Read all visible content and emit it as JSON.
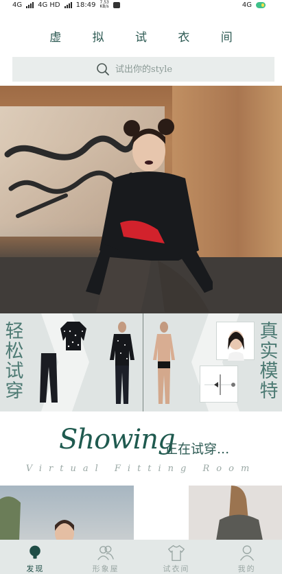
{
  "status_bar": {
    "network_left": "4G",
    "network_left_2": "4G HD",
    "time": "18:49",
    "speed": "7.53 KB/s",
    "network_right": "4G",
    "battery_color": "#3ec08a"
  },
  "header": {
    "title": "虚 拟 试 衣 间"
  },
  "search": {
    "placeholder": "试出你的style",
    "icon": "search-icon"
  },
  "banner": {
    "slide_count": 5,
    "active_slide": 3
  },
  "features": {
    "left_label": "轻松试穿",
    "right_label": "真实模特"
  },
  "showing": {
    "script_text": "Showing",
    "chinese_text": "正在试穿...",
    "subtitle": "Virtual Fitting Room"
  },
  "tabbar": {
    "items": [
      {
        "label": "发现",
        "icon": "lightbulb-icon",
        "active": true
      },
      {
        "label": "形象屋",
        "icon": "users-icon",
        "active": false
      },
      {
        "label": "试衣间",
        "icon": "shirt-icon",
        "active": false
      },
      {
        "label": "我的",
        "icon": "user-icon",
        "active": false
      }
    ]
  },
  "colors": {
    "accent": "#1f4d46",
    "tab_inactive": "#9aa7a4",
    "panel_bg": "#dfe4e3"
  }
}
